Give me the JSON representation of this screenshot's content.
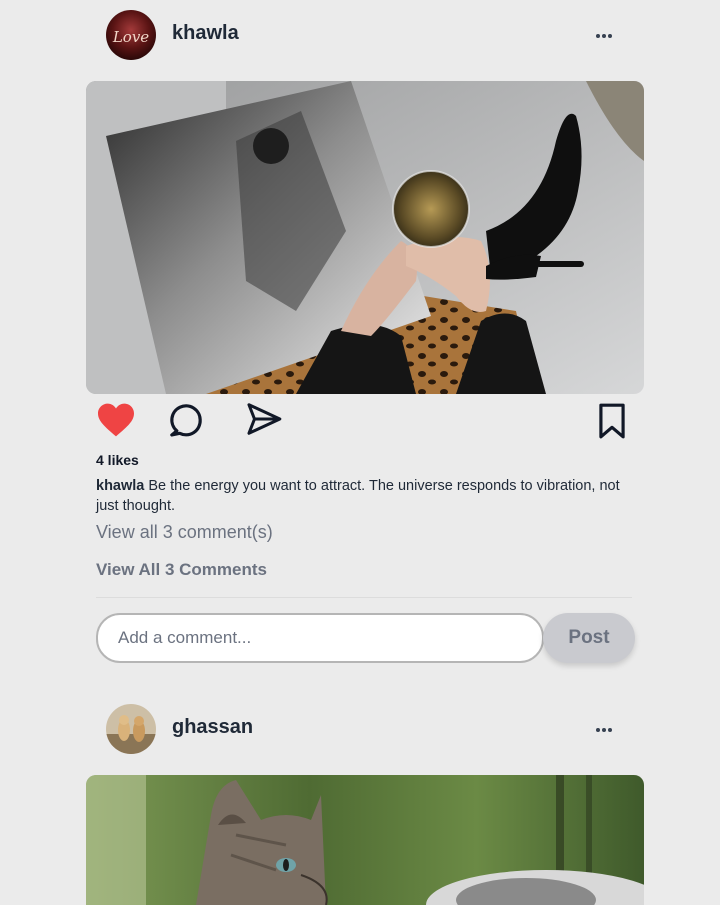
{
  "posts": [
    {
      "username": "khawla",
      "avatar_text": "Love",
      "likes": "4 likes",
      "caption_user": "khawla",
      "caption_text": "Be the energy you want to attract. The universe responds to vibration, not just thought.",
      "view_comments": "View all 3 comment(s)",
      "view_all": "View All 3 Comments",
      "comment_placeholder": "Add a comment...",
      "post_label": "Post",
      "liked": true
    },
    {
      "username": "ghassan"
    }
  ],
  "colors": {
    "background": "#ebebeb",
    "like_red": "#ef4444",
    "icon_dark": "#111827",
    "muted_text": "#6b7280",
    "post_button_bg": "#c9cacf"
  },
  "icons": [
    "more-icon",
    "heart-icon",
    "comment-icon",
    "share-icon",
    "bookmark-icon"
  ]
}
